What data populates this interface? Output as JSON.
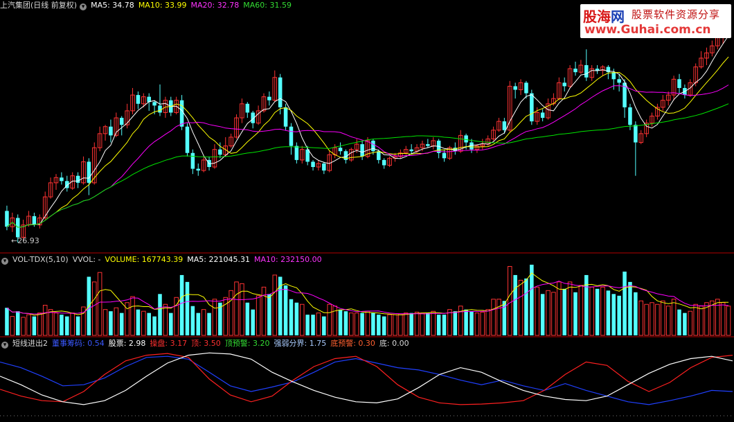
{
  "colors": {
    "up": "#ff3333",
    "down": "#54ffff",
    "ma5": "#ffffff",
    "ma10": "#ffff00",
    "ma20": "#ff00ff",
    "ma60": "#00e600",
    "white_line": "#ffffff",
    "red_line": "#ff2020",
    "blue_line": "#2040ff",
    "separator": "#b40000"
  },
  "header_main": {
    "title": "上汽集团(日线 前复权)",
    "icon": "circle-dropdown-icon",
    "ma5": "MA5: 34.78",
    "ma10": "MA10: 33.99",
    "ma20": "MA20: 32.78",
    "ma60": "MA60: 31.59"
  },
  "header_vol": {
    "title": "VOL-TDX(5,10)",
    "vvol": "VVOL: -",
    "volume": "VOLUME: 167743.39",
    "ma5": "MA5: 221045.31",
    "ma10": "MA10: 232150.00"
  },
  "header_ind": {
    "title": "短线进出2",
    "zhuli": "董事筹码: 0.54",
    "gupiao": "股票: 2.98",
    "caopan": "操盘: 3.17",
    "ding": "顶: 3.50",
    "dingyujing": "顶预警: 3.20",
    "qiangruo": "强弱分界: 1.75",
    "diyujing": "底预警: 0.30",
    "di": "底: 0.00"
  },
  "min_label": "←26.93",
  "watermark": {
    "brand_a": "股海",
    "brand_b": "网",
    "slogan": "股票软件资源分享",
    "url": "www.Guhai.com.cn"
  },
  "chart_data": {
    "type": "candlestick",
    "price_range": [
      25.8,
      38.2
    ],
    "min_price": 26.93,
    "candles": [
      [
        28.7,
        27.8,
        29.0,
        27.6
      ],
      [
        27.8,
        28.3,
        28.6,
        27.5
      ],
      [
        28.3,
        27.2,
        28.5,
        26.9
      ],
      [
        27.2,
        27.9,
        28.2,
        27.0
      ],
      [
        27.9,
        28.4,
        28.7,
        27.8
      ],
      [
        28.4,
        27.9,
        28.6,
        27.8
      ],
      [
        27.9,
        28.3,
        28.5,
        27.7
      ],
      [
        28.3,
        29.5,
        29.8,
        28.2
      ],
      [
        29.5,
        30.3,
        30.6,
        29.4
      ],
      [
        30.3,
        30.6,
        30.8,
        29.9
      ],
      [
        30.6,
        30.4,
        30.9,
        30.2
      ],
      [
        30.4,
        30.0,
        30.7,
        29.8
      ],
      [
        30.0,
        30.7,
        30.9,
        29.9
      ],
      [
        30.7,
        30.3,
        30.9,
        30.0
      ],
      [
        30.3,
        31.5,
        31.8,
        30.2
      ],
      [
        31.5,
        30.3,
        31.7,
        29.6
      ],
      [
        30.3,
        32.3,
        32.6,
        30.2
      ],
      [
        32.3,
        33.1,
        33.5,
        32.1
      ],
      [
        33.1,
        33.5,
        33.6,
        32.7
      ],
      [
        33.5,
        33.0,
        33.9,
        32.6
      ],
      [
        33.0,
        34.0,
        34.3,
        32.9
      ],
      [
        34.0,
        33.6,
        34.1,
        33.0
      ],
      [
        33.6,
        34.4,
        34.8,
        33.4
      ],
      [
        34.4,
        35.3,
        35.7,
        34.2
      ],
      [
        35.3,
        34.8,
        35.5,
        34.5
      ],
      [
        34.8,
        35.2,
        35.4,
        34.6
      ],
      [
        35.2,
        34.9,
        35.4,
        34.4
      ],
      [
        34.9,
        34.7,
        35.0,
        34.2
      ],
      [
        34.7,
        34.3,
        35.9,
        34.1
      ],
      [
        34.3,
        35.0,
        35.2,
        34.0
      ],
      [
        35.0,
        34.3,
        35.2,
        34.1
      ],
      [
        34.3,
        35.0,
        35.2,
        34.2
      ],
      [
        35.0,
        33.5,
        35.3,
        33.3
      ],
      [
        33.5,
        32.0,
        33.7,
        31.8
      ],
      [
        32.0,
        31.1,
        32.2,
        30.8
      ],
      [
        31.1,
        31.0,
        31.4,
        30.7
      ],
      [
        31.0,
        31.6,
        31.8,
        30.9
      ],
      [
        31.6,
        31.2,
        31.8,
        31.0
      ],
      [
        31.2,
        32.2,
        32.5,
        31.1
      ],
      [
        32.2,
        31.9,
        32.6,
        31.7
      ],
      [
        31.9,
        32.4,
        32.9,
        31.8
      ],
      [
        32.4,
        32.9,
        33.1,
        32.3
      ],
      [
        32.9,
        34.0,
        34.2,
        32.8
      ],
      [
        34.0,
        34.8,
        35.1,
        33.7
      ],
      [
        34.8,
        34.3,
        34.9,
        34.0
      ],
      [
        34.3,
        33.7,
        34.4,
        33.4
      ],
      [
        33.7,
        34.4,
        34.7,
        33.6
      ],
      [
        34.4,
        35.2,
        35.4,
        34.3
      ],
      [
        35.2,
        35.0,
        35.5,
        34.7
      ],
      [
        35.0,
        36.3,
        36.7,
        34.9
      ],
      [
        36.3,
        34.6,
        36.5,
        34.2
      ],
      [
        34.6,
        33.5,
        34.8,
        33.3
      ],
      [
        33.5,
        32.4,
        33.7,
        31.9
      ],
      [
        32.4,
        31.6,
        32.6,
        31.4
      ],
      [
        31.6,
        32.2,
        32.4,
        31.4
      ],
      [
        32.2,
        31.5,
        32.4,
        31.3
      ],
      [
        31.5,
        31.2,
        31.6,
        31.0
      ],
      [
        31.2,
        31.4,
        31.6,
        31.0
      ],
      [
        31.4,
        31.0,
        31.5,
        30.8
      ],
      [
        31.0,
        31.9,
        32.1,
        30.9
      ],
      [
        31.9,
        32.3,
        32.5,
        31.7
      ],
      [
        32.3,
        32.1,
        32.6,
        31.9
      ],
      [
        32.1,
        31.6,
        32.2,
        31.4
      ],
      [
        31.6,
        32.2,
        32.3,
        31.5
      ],
      [
        32.2,
        32.5,
        32.8,
        32.0
      ],
      [
        32.5,
        31.8,
        32.7,
        31.6
      ],
      [
        31.8,
        32.7,
        32.9,
        31.7
      ],
      [
        32.7,
        32.1,
        32.8,
        31.9
      ],
      [
        32.1,
        31.6,
        32.2,
        31.4
      ],
      [
        31.6,
        31.3,
        31.7,
        31.1
      ],
      [
        31.3,
        31.7,
        31.8,
        31.2
      ],
      [
        31.7,
        31.8,
        32.0,
        31.5
      ],
      [
        31.8,
        32.0,
        32.2,
        31.7
      ],
      [
        32.0,
        32.2,
        32.4,
        31.9
      ],
      [
        32.2,
        32.1,
        32.5,
        31.9
      ],
      [
        32.1,
        32.3,
        32.5,
        32.0
      ],
      [
        32.3,
        32.5,
        32.7,
        32.1
      ],
      [
        32.5,
        32.4,
        32.8,
        32.3
      ],
      [
        32.4,
        32.7,
        32.9,
        32.2
      ],
      [
        32.7,
        32.0,
        32.8,
        31.7
      ],
      [
        32.0,
        31.7,
        32.2,
        31.5
      ],
      [
        31.7,
        32.3,
        32.4,
        31.6
      ],
      [
        32.3,
        32.1,
        32.6,
        31.9
      ],
      [
        32.1,
        33.0,
        33.3,
        32.0
      ],
      [
        33.0,
        32.6,
        33.1,
        32.2
      ],
      [
        32.6,
        32.2,
        32.8,
        32.0
      ],
      [
        32.2,
        32.4,
        32.5,
        32.0
      ],
      [
        32.4,
        32.5,
        32.8,
        32.2
      ],
      [
        32.5,
        32.8,
        33.0,
        32.4
      ],
      [
        32.8,
        33.3,
        33.5,
        32.7
      ],
      [
        33.3,
        33.8,
        34.0,
        33.2
      ],
      [
        33.8,
        33.3,
        34.0,
        33.1
      ],
      [
        33.3,
        35.8,
        36.1,
        33.2
      ],
      [
        35.8,
        35.6,
        36.0,
        35.1
      ],
      [
        35.6,
        36.0,
        36.2,
        35.3
      ],
      [
        36.0,
        35.4,
        36.1,
        35.1
      ],
      [
        35.4,
        33.8,
        35.6,
        33.6
      ],
      [
        33.8,
        34.3,
        34.6,
        33.6
      ],
      [
        34.3,
        34.0,
        34.5,
        33.8
      ],
      [
        34.0,
        34.8,
        35.1,
        33.9
      ],
      [
        34.8,
        35.1,
        35.4,
        34.7
      ],
      [
        35.1,
        36.0,
        36.3,
        35.0
      ],
      [
        36.0,
        35.8,
        36.3,
        35.5
      ],
      [
        35.8,
        36.8,
        37.0,
        35.7
      ],
      [
        36.8,
        36.6,
        37.2,
        36.4
      ],
      [
        36.6,
        37.0,
        37.3,
        36.5
      ],
      [
        37.0,
        36.3,
        37.9,
        36.1
      ],
      [
        36.3,
        36.8,
        37.0,
        36.1
      ],
      [
        36.8,
        36.7,
        37.0,
        36.5
      ],
      [
        36.7,
        36.9,
        37.0,
        36.4
      ],
      [
        36.9,
        36.6,
        37.0,
        36.2
      ],
      [
        36.6,
        36.2,
        36.8,
        35.6
      ],
      [
        36.2,
        36.0,
        36.5,
        35.5
      ],
      [
        36.0,
        34.6,
        36.2,
        34.0
      ],
      [
        34.6,
        33.6,
        34.8,
        33.3
      ],
      [
        33.6,
        32.6,
        33.8,
        30.7
      ],
      [
        32.6,
        33.1,
        33.3,
        32.5
      ],
      [
        33.1,
        33.7,
        33.9,
        32.9
      ],
      [
        33.7,
        34.1,
        34.3,
        33.5
      ],
      [
        34.1,
        34.6,
        34.8,
        33.9
      ],
      [
        34.6,
        35.0,
        35.3,
        34.4
      ],
      [
        35.0,
        35.3,
        35.5,
        34.7
      ],
      [
        35.3,
        36.2,
        36.4,
        35.0
      ],
      [
        36.2,
        35.7,
        36.5,
        35.4
      ],
      [
        35.7,
        35.3,
        35.9,
        35.1
      ],
      [
        35.3,
        36.0,
        36.2,
        35.2
      ],
      [
        36.0,
        36.9,
        37.1,
        35.8
      ],
      [
        36.9,
        37.4,
        37.8,
        36.8
      ],
      [
        37.4,
        37.7,
        38.0,
        37.0
      ],
      [
        37.7,
        38.1,
        38.4,
        37.5
      ],
      [
        38.1,
        38.6,
        38.9,
        37.9
      ],
      [
        38.6,
        39.3,
        39.5,
        38.2
      ],
      [
        39.3,
        39.7,
        40.0,
        39.0
      ]
    ],
    "volumes": [
      0.32,
      0.22,
      0.28,
      0.21,
      0.24,
      0.22,
      0.26,
      0.35,
      0.3,
      0.26,
      0.24,
      0.22,
      0.26,
      0.22,
      0.33,
      0.68,
      0.62,
      0.73,
      0.3,
      0.28,
      0.32,
      0.26,
      0.38,
      0.45,
      0.3,
      0.28,
      0.26,
      0.22,
      0.48,
      0.36,
      0.26,
      0.44,
      0.7,
      0.62,
      0.34,
      0.26,
      0.3,
      0.26,
      0.42,
      0.38,
      0.44,
      0.52,
      0.62,
      0.6,
      0.38,
      0.3,
      0.46,
      0.56,
      0.48,
      0.7,
      0.68,
      0.58,
      0.42,
      0.38,
      0.36,
      0.24,
      0.24,
      0.26,
      0.22,
      0.36,
      0.34,
      0.3,
      0.28,
      0.26,
      0.26,
      0.26,
      0.28,
      0.26,
      0.24,
      0.22,
      0.24,
      0.24,
      0.25,
      0.26,
      0.26,
      0.27,
      0.26,
      0.26,
      0.28,
      0.24,
      0.24,
      0.3,
      0.28,
      0.34,
      0.3,
      0.28,
      0.26,
      0.27,
      0.3,
      0.42,
      0.42,
      0.4,
      0.8,
      0.7,
      0.64,
      0.66,
      0.82,
      0.56,
      0.48,
      0.52,
      0.5,
      0.62,
      0.54,
      0.62,
      0.5,
      0.58,
      0.7,
      0.56,
      0.54,
      0.56,
      0.52,
      0.48,
      0.46,
      0.74,
      0.62,
      0.5,
      0.4,
      0.36,
      0.38,
      0.36,
      0.4,
      0.34,
      0.42,
      0.3,
      0.26,
      0.28,
      0.36,
      0.34,
      0.38,
      0.4,
      0.42,
      0.38,
      0.34
    ],
    "white_line": [
      0.55,
      0.4,
      0.22,
      0.1,
      0.05,
      0.12,
      0.3,
      0.55,
      0.78,
      0.92,
      0.96,
      0.94,
      0.85,
      0.62,
      0.45,
      0.3,
      0.18,
      0.1,
      0.08,
      0.15,
      0.35,
      0.58,
      0.7,
      0.62,
      0.45,
      0.3,
      0.2,
      0.14,
      0.12,
      0.2,
      0.4,
      0.6,
      0.76,
      0.86,
      0.9,
      0.82
    ],
    "red_line": [
      0.32,
      0.2,
      0.12,
      0.1,
      0.28,
      0.58,
      0.82,
      0.92,
      0.95,
      0.88,
      0.5,
      0.22,
      0.1,
      0.2,
      0.48,
      0.72,
      0.86,
      0.9,
      0.72,
      0.4,
      0.18,
      0.08,
      0.05,
      0.06,
      0.08,
      0.12,
      0.3,
      0.58,
      0.8,
      0.74,
      0.46,
      0.28,
      0.44,
      0.7,
      0.88,
      0.92
    ],
    "blue_line": [
      0.8,
      0.7,
      0.55,
      0.38,
      0.4,
      0.52,
      0.72,
      0.88,
      0.9,
      0.85,
      0.62,
      0.38,
      0.28,
      0.36,
      0.45,
      0.62,
      0.8,
      0.86,
      0.78,
      0.7,
      0.66,
      0.58,
      0.48,
      0.4,
      0.48,
      0.38,
      0.3,
      0.42,
      0.3,
      0.2,
      0.1,
      0.05,
      0.12,
      0.2,
      0.3,
      0.28
    ]
  }
}
